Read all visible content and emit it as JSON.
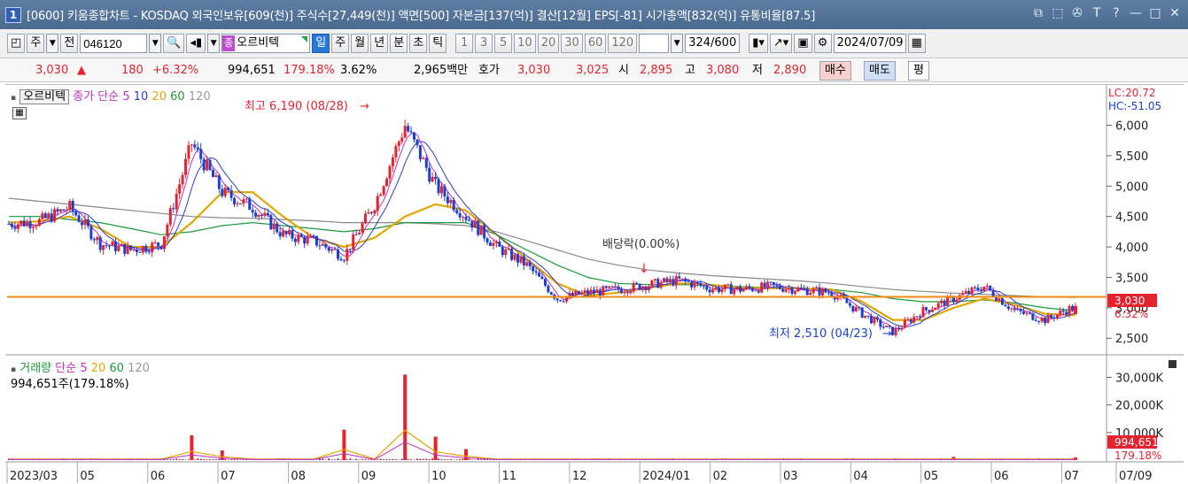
{
  "window": {
    "number": "1",
    "title": "[0600] 키움종합차트 - KOSDAQ 외국인보유[609(천)] 주식수[27,449(천)] 액면[500] 자본금[137(억)] 결산[12월] EPS[-81] 시가총액[832(억)] 유통비율[87.5]",
    "controls": [
      "⧉",
      "⬚",
      "✇",
      "T",
      "?",
      "—",
      "□",
      "✕"
    ]
  },
  "toolbar": {
    "market_label": "주",
    "prev_label": "전",
    "stock_code": "046120",
    "stock_badge": "종",
    "stock_name": "오르비텍",
    "periods": [
      "일",
      "주",
      "월",
      "년",
      "분",
      "초",
      "틱"
    ],
    "active_period": "일",
    "intervals": [
      "1",
      "3",
      "5",
      "10",
      "20",
      "30",
      "60",
      "120"
    ],
    "count_value": "324",
    "count_total": "/600",
    "date": "2024/07/09"
  },
  "info": {
    "price": "3,030",
    "change": "180",
    "change_pct": "+6.32%",
    "volume": "994,651",
    "volume_ratio": "179.18%",
    "turnover": "3.62%",
    "amount": "2,965백만",
    "quote_label": "호가",
    "ask": "3,030",
    "bid": "3,025",
    "open_label": "시",
    "open": "2,895",
    "high_label": "고",
    "high": "3,080",
    "low_label": "저",
    "low": "2,890",
    "buy_label": "매수",
    "sell_label": "매도",
    "avg_label": "평"
  },
  "price_panel": {
    "legend_name": "오르비텍",
    "legend_series": "종가 단순",
    "ma_labels": [
      "5",
      "10",
      "20",
      "60",
      "120"
    ],
    "lc": "LC:20.72",
    "hc": "HC:-51.05",
    "high_annotation": "최고 6,190 (08/28)",
    "low_annotation": "최저 2,510 (04/23)",
    "dividend_annotation": "배당락(0.00%)",
    "current_price_tag": "3,030",
    "current_pct_tag": "6.32%"
  },
  "volume_panel": {
    "legend_name": "거래량",
    "legend_series": "단순",
    "ma_labels": [
      "5",
      "20",
      "60",
      "120"
    ],
    "current_label": "994,651주(179.18%)",
    "current_tag": "994,651",
    "current_pct_tag": "179.18%"
  },
  "colors": {
    "up": "#e5232e",
    "down": "#1b3fd0",
    "ma5": "#c030c0",
    "ma10": "#2a3fc8",
    "ma20": "#e2a600",
    "ma60": "#1a9a3a",
    "ma120": "#888888",
    "hline": "#f08a10"
  },
  "chart_data": {
    "type": "candlestick",
    "price_axis": {
      "ticks": [
        2500,
        3000,
        3500,
        4000,
        4500,
        5000,
        5500,
        6000
      ],
      "tick_labels": [
        "2,500",
        "3,000",
        "3,500",
        "4,000",
        "4,500",
        "5,000",
        "5,500",
        "6,000"
      ],
      "range": [
        2300,
        6400
      ]
    },
    "volume_axis": {
      "ticks": [
        10000,
        20000,
        30000
      ],
      "tick_labels": [
        "10,000K",
        "20,000K",
        "30,000K"
      ],
      "range": [
        0,
        34000
      ],
      "unit": "K"
    },
    "x_labels": [
      "2023/03",
      "05",
      "06",
      "07",
      "08",
      "09",
      "10",
      "11",
      "12",
      "2024/01",
      "02",
      "03",
      "04",
      "05",
      "06",
      "07",
      "07/09"
    ],
    "horizontal_line": 3180,
    "close_path": [
      {
        "t": "2023/03",
        "v": 4380
      },
      {
        "t": "2023/04",
        "v": 4420
      },
      {
        "t": "2023/04m",
        "v": 4650
      },
      {
        "t": "2023/05",
        "v": 4050
      },
      {
        "t": "2023/05m",
        "v": 3950
      },
      {
        "t": "2023/06",
        "v": 4050
      },
      {
        "t": "2023/06m",
        "v": 5700
      },
      {
        "t": "2023/06e",
        "v": 4900
      },
      {
        "t": "2023/07",
        "v": 4650
      },
      {
        "t": "2023/07m",
        "v": 4200
      },
      {
        "t": "2023/08",
        "v": 4100
      },
      {
        "t": "2023/08m",
        "v": 3850
      },
      {
        "t": "2023/08e",
        "v": 4700
      },
      {
        "t": "2023/08/28",
        "v": 6000
      },
      {
        "t": "2023/09",
        "v": 5000
      },
      {
        "t": "2023/09m",
        "v": 4500
      },
      {
        "t": "2023/10",
        "v": 4000
      },
      {
        "t": "2023/10m",
        "v": 3700
      },
      {
        "t": "2023/11",
        "v": 3150
      },
      {
        "t": "2023/11m",
        "v": 3250
      },
      {
        "t": "2023/12",
        "v": 3300
      },
      {
        "t": "2023/12m",
        "v": 3380
      },
      {
        "t": "2024/01",
        "v": 3450
      },
      {
        "t": "2024/01m",
        "v": 3320
      },
      {
        "t": "2024/02",
        "v": 3300
      },
      {
        "t": "2024/02m",
        "v": 3350
      },
      {
        "t": "2024/03",
        "v": 3300
      },
      {
        "t": "2024/03m",
        "v": 3250
      },
      {
        "t": "2024/04",
        "v": 2900
      },
      {
        "t": "2024/04/23",
        "v": 2600
      },
      {
        "t": "2024/05",
        "v": 2950
      },
      {
        "t": "2024/05m",
        "v": 3150
      },
      {
        "t": "2024/06",
        "v": 3350
      },
      {
        "t": "2024/06m",
        "v": 2950
      },
      {
        "t": "2024/07",
        "v": 2800
      },
      {
        "t": "2024/07/09",
        "v": 3030
      }
    ],
    "ma20_path": [
      4400,
      4420,
      4500,
      4300,
      4000,
      4000,
      4400,
      4900,
      4900,
      4500,
      4150,
      4000,
      4150,
      4500,
      4700,
      4600,
      4200,
      3800,
      3400,
      3200,
      3250,
      3330,
      3400,
      3380,
      3330,
      3320,
      3320,
      3300,
      3100,
      2800,
      2800,
      3000,
      3150,
      3050,
      2900,
      2880
    ],
    "ma60_path": [
      4500,
      4500,
      4450,
      4400,
      4300,
      4200,
      4250,
      4350,
      4400,
      4350,
      4300,
      4250,
      4300,
      4400,
      4400,
      4400,
      4200,
      3950,
      3700,
      3500,
      3400,
      3380,
      3380,
      3370,
      3350,
      3330,
      3320,
      3300,
      3250,
      3150,
      3100,
      3100,
      3130,
      3080,
      3000,
      2950
    ],
    "ma120_path": [
      4800,
      4750,
      4700,
      4650,
      4600,
      4550,
      4500,
      4480,
      4470,
      4450,
      4430,
      4400,
      4400,
      4400,
      4380,
      4350,
      4250,
      4100,
      3950,
      3800,
      3700,
      3620,
      3570,
      3530,
      3500,
      3470,
      3440,
      3400,
      3350,
      3300,
      3270,
      3240,
      3220,
      3200,
      3180,
      3170
    ],
    "volume_spikes": [
      {
        "t": "2023/06m",
        "v": 9000
      },
      {
        "t": "2023/06e",
        "v": 3500
      },
      {
        "t": "2023/08/28",
        "v": 31000
      },
      {
        "t": "2023/08m",
        "v": 11000
      },
      {
        "t": "2023/09",
        "v": 8500
      },
      {
        "t": "2023/09m",
        "v": 4000
      },
      {
        "t": "2024/05m",
        "v": 1200
      },
      {
        "t": "2024/07/09",
        "v": 995
      }
    ]
  }
}
